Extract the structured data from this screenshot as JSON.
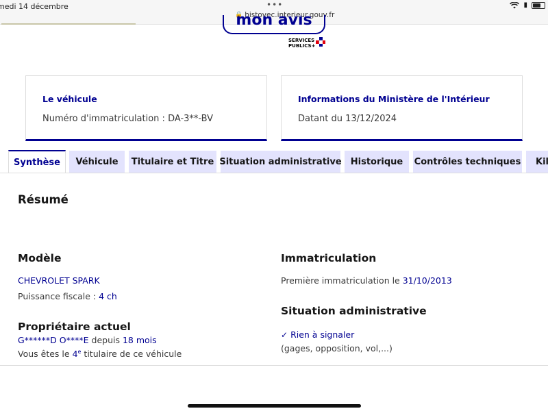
{
  "status_bar": {
    "time": "medi 14 décembre",
    "url": "histovec.interieur.gouv.fr"
  },
  "logo": {
    "text": "mon avis",
    "services_line1": "SERVICES",
    "services_line2": "PUBLICS+"
  },
  "cards": {
    "vehicle": {
      "title": "Le véhicule",
      "text": "Numéro d'immatriculation : DA-3**-BV"
    },
    "ministry": {
      "title": "Informations du Ministère de l'Intérieur",
      "text": "Datant du 13/12/2024"
    }
  },
  "tabs": [
    {
      "label": "Synthèse",
      "active": true
    },
    {
      "label": "Véhicule",
      "active": false
    },
    {
      "label": "Titulaire et Titre",
      "active": false
    },
    {
      "label": "Situation administrative",
      "active": false
    },
    {
      "label": "Historique",
      "active": false
    },
    {
      "label": "Contrôles techniques",
      "active": false
    },
    {
      "label": "Kilo",
      "active": false
    }
  ],
  "summary": {
    "title": "Résumé",
    "model": {
      "heading": "Modèle",
      "name": "CHEVROLET SPARK",
      "power_label": "Puissance fiscale :",
      "power_value": "4 ch"
    },
    "owner": {
      "heading": "Propriétaire actuel",
      "name": "G******D O****E",
      "since_label": "depuis",
      "since_value": "18 mois",
      "rank_prefix": "Vous êtes le",
      "rank_number": "4",
      "rank_sup": "e",
      "rank_suffix": "titulaire de ce véhicule"
    },
    "registration": {
      "heading": "Immatriculation",
      "first_label": "Première immatriculation le",
      "first_date": "31/10/2013"
    },
    "admin": {
      "heading": "Situation administrative",
      "status": "Rien à signaler",
      "detail": "(gages, opposition, vol,...)"
    }
  }
}
